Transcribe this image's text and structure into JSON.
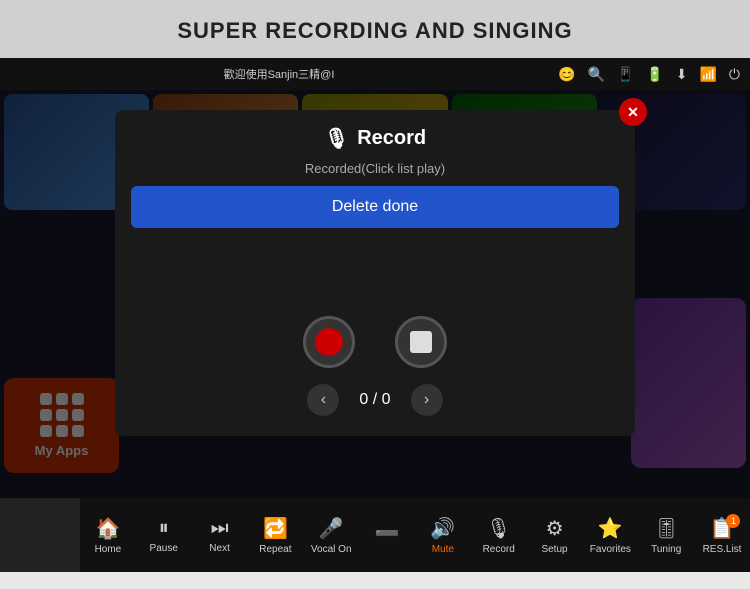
{
  "header": {
    "title": "SUPER RECORDING AND SINGING"
  },
  "statusBar": {
    "welcomeText": "歡迎使用Sanjin三精@I",
    "icons": [
      "😊",
      "🔍",
      "📱",
      "🔋",
      "⬇",
      "📶",
      "⏻"
    ]
  },
  "modal": {
    "title": "Record",
    "closeLabel": "✕",
    "subtitle": "Recorded(Click list play)",
    "deleteDoneLabel": "Delete done",
    "pagination": {
      "current": "0 / 0"
    }
  },
  "myApps": {
    "label": "My Apps"
  },
  "bottomNav": {
    "items": [
      {
        "icon": "🏠",
        "label": "Home"
      },
      {
        "icon": "⏸",
        "label": "Pause"
      },
      {
        "icon": "⏭",
        "label": "Next"
      },
      {
        "icon": "🔁",
        "label": "Repeat"
      },
      {
        "icon": "🎤",
        "label": "Vocal On"
      },
      {
        "icon": "➖",
        "label": ""
      },
      {
        "icon": "🔊",
        "label": "Mute"
      },
      {
        "icon": "🎙",
        "label": "Record"
      },
      {
        "icon": "⚙",
        "label": "Setup"
      },
      {
        "icon": "⭐",
        "label": "Favorites"
      },
      {
        "icon": "🎚",
        "label": "Tuning"
      },
      {
        "icon": "📋",
        "label": "RES.List",
        "badge": "1"
      }
    ]
  }
}
